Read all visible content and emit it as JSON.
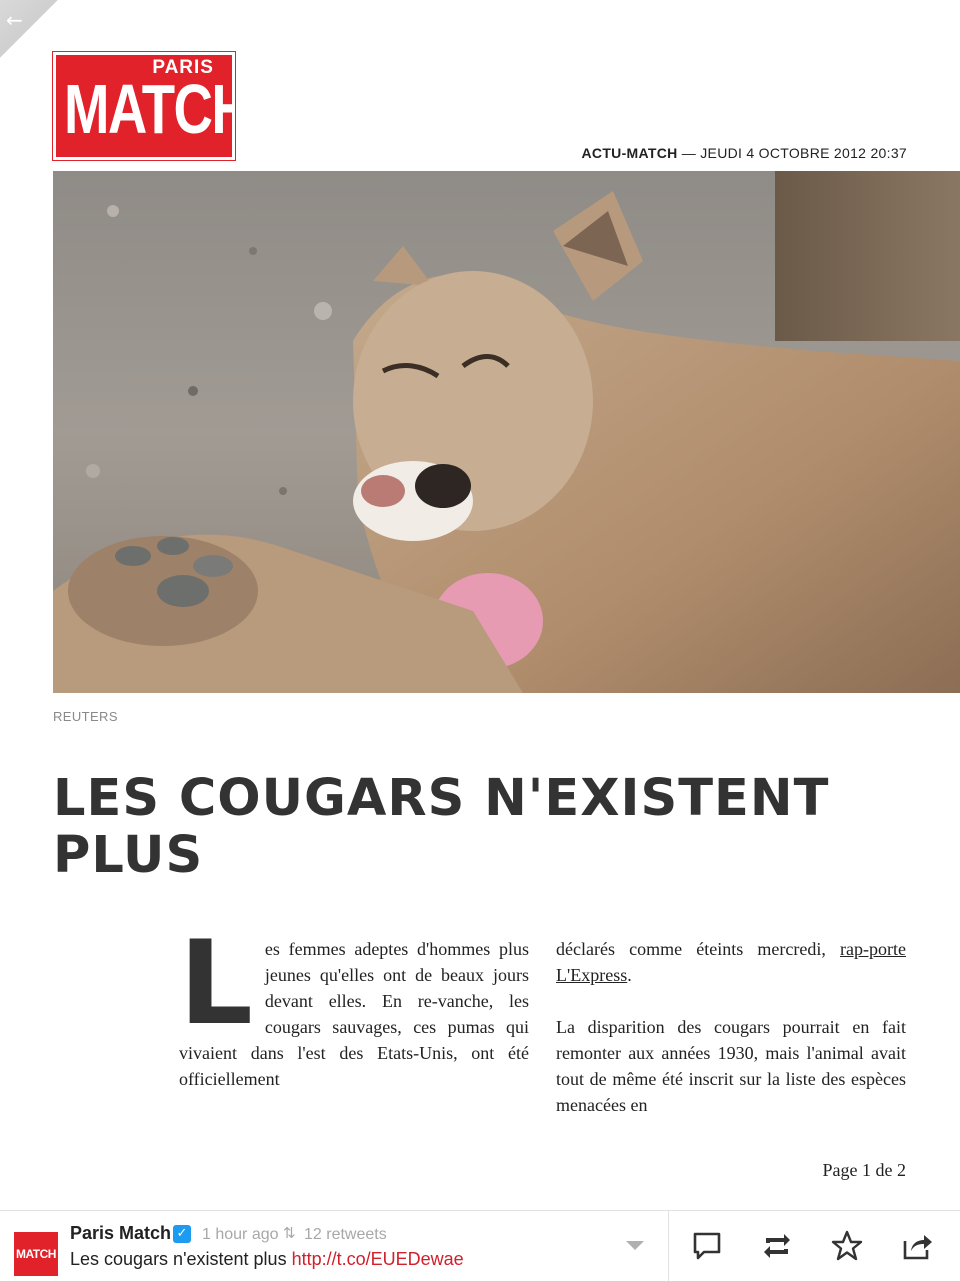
{
  "nav": {
    "back_icon": "back-arrow-icon"
  },
  "header": {
    "logo": {
      "line1": "PARIS",
      "line2": "MATCH",
      "brand_color": "#e1222a"
    },
    "section": "ACTU-MATCH",
    "separator": " — ",
    "date": "JEUDI 4 OCTOBRE 2012 20:37"
  },
  "article": {
    "photo_credit": "REUTERS",
    "headline_line1": "LES COUGARS N'EXISTENT",
    "headline_line2": "PLUS",
    "dropcap": "L",
    "p1_text": "es femmes adeptes d'hommes plus jeunes qu'elles ont de beaux jours devant elles. En re-vanche, les cougars sauvages, ces pumas qui vivaient dans l'est des Etats-Unis, ont été officiellement",
    "p1_cont_text": "déclarés comme éteints mercredi, ",
    "p1_link": "rap-porte L'Express",
    "p1_end": ".",
    "p2_text": "La disparition des cougars pourrait en fait remonter aux années 1930, mais l'animal avait tout de même été inscrit sur la liste des espèces menacées en"
  },
  "pager": {
    "label": "Page 1 de 2"
  },
  "tweet": {
    "avatar_text": "MATCH",
    "account_name": "Paris Match",
    "verified_icon": "verified-badge-icon",
    "time": "1 hour ago",
    "retweet_icon": "retweet-small-icon",
    "retweets": "12 retweets",
    "text": "Les cougars n'existent plus ",
    "link": "http://t.co/EUEDewae",
    "link_color": "#d0202a",
    "actions": [
      "reply-icon",
      "retweet-icon",
      "favorite-star-icon",
      "share-icon"
    ]
  }
}
